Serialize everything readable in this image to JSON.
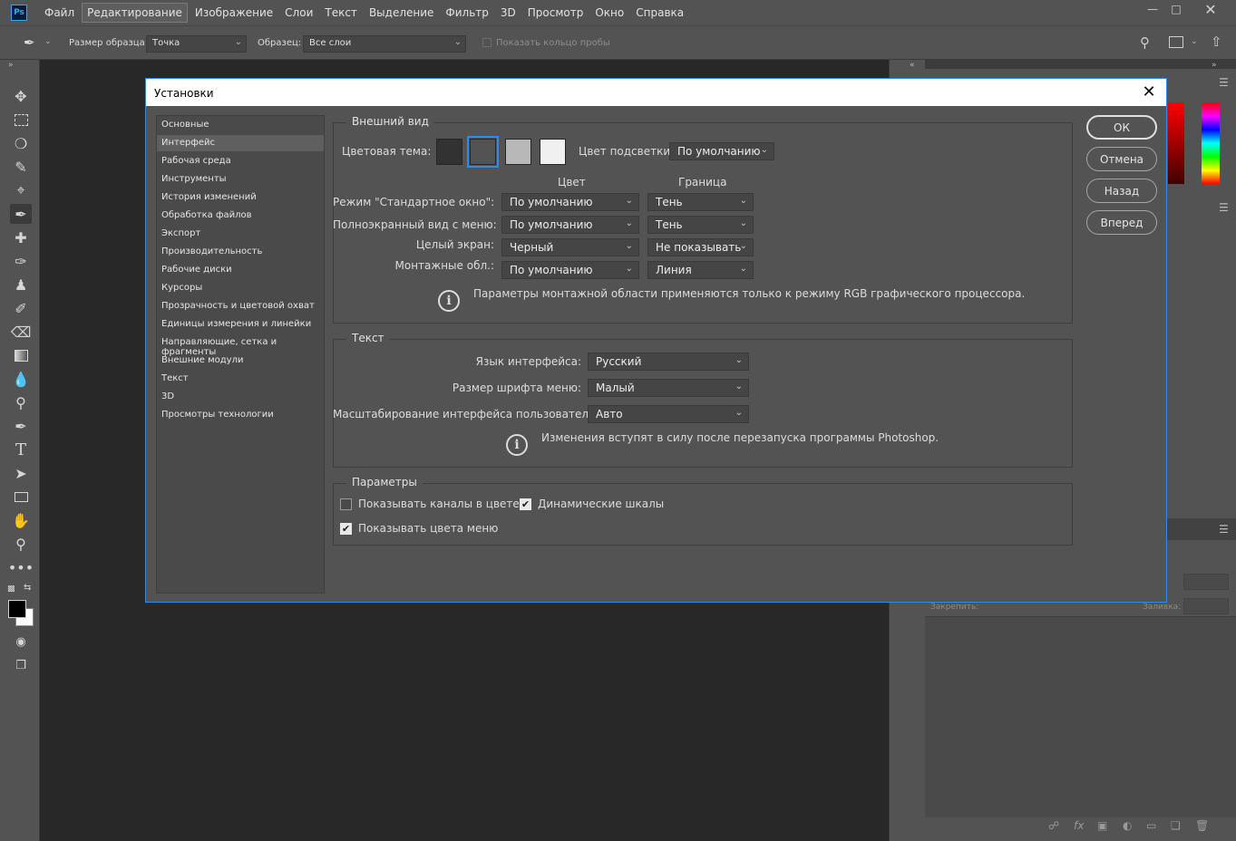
{
  "menubar": {
    "logo": "Ps",
    "items": [
      "Файл",
      "Редактирование",
      "Изображение",
      "Слои",
      "Текст",
      "Выделение",
      "Фильтр",
      "3D",
      "Просмотр",
      "Окно",
      "Справка"
    ]
  },
  "optbar": {
    "sample_size_label": "Размер образца:",
    "sample_size_value": "Точка",
    "sample_label": "Образец:",
    "sample_value": "Все слои",
    "show_ring_label": "Показать кольцо пробы"
  },
  "dialog": {
    "title": "Установки",
    "nav": [
      "Основные",
      "Интерфейс",
      "Рабочая среда",
      "Инструменты",
      "История изменений",
      "Обработка файлов",
      "Экспорт",
      "Производительность",
      "Рабочие диски",
      "Курсоры",
      "Прозрачность и цветовой охват",
      "Единицы измерения и линейки",
      "Направляющие, сетка и фрагменты",
      "Внешние модули",
      "Текст",
      "3D",
      "Просмотры технологии"
    ],
    "appearance": {
      "legend": "Внешний вид",
      "theme_label": "Цветовая тема:",
      "theme_colors": [
        "#323232",
        "#535353",
        "#b8b8b8",
        "#f0f0f0"
      ],
      "highlight_label": "Цвет подсветки:",
      "highlight_value": "По умолчанию",
      "col_color": "Цвет",
      "col_border": "Граница",
      "rows": [
        {
          "label": "Режим \"Стандартное окно\":",
          "color": "По умолчанию",
          "border": "Тень"
        },
        {
          "label": "Полноэкранный вид с меню:",
          "color": "По умолчанию",
          "border": "Тень"
        },
        {
          "label": "Целый экран:",
          "color": "Черный",
          "border": "Не показывать"
        },
        {
          "label": "Монтажные обл.:",
          "color": "По умолчанию",
          "border": "Линия"
        }
      ],
      "info": "Параметры монтажной области применяются только к режиму RGB графического процессора."
    },
    "text": {
      "legend": "Текст",
      "lang_label": "Язык интерфейса:",
      "lang_value": "Русский",
      "font_label": "Размер шрифта меню:",
      "font_value": "Малый",
      "scale_label": "Масштабирование интерфейса пользователя:",
      "scale_value": "Авто",
      "info": "Изменения вступят в силу после перезапуска программы Photoshop."
    },
    "params": {
      "legend": "Параметры",
      "chk_channels": "Показывать каналы в цвете",
      "chk_dynamic": "Динамические шкалы",
      "chk_menu_colors": "Показывать цвета меню"
    },
    "buttons": {
      "ok": "ОК",
      "cancel": "Отмена",
      "back": "Назад",
      "forward": "Вперед"
    }
  },
  "panels": {
    "lock_label": "Закрепить:",
    "fill_label": "Заливка:"
  }
}
